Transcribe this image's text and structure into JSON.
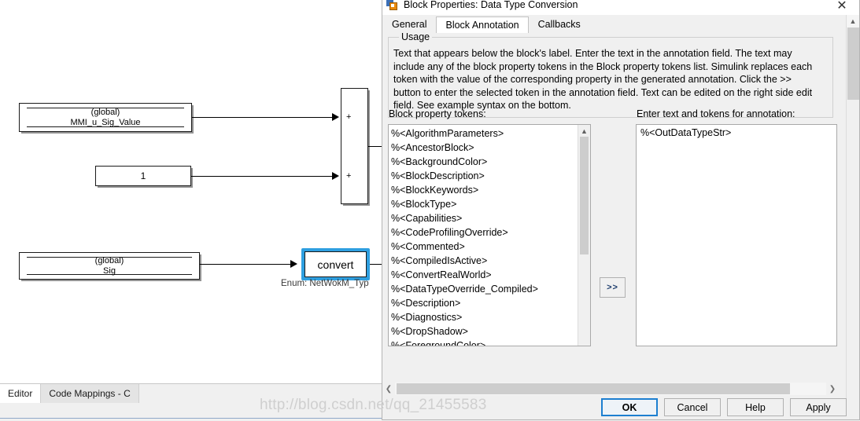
{
  "canvas": {
    "blocks": [
      {
        "name": "data-store-mmi",
        "scope": "(global)",
        "label": "MMI_u_Sig_Value"
      },
      {
        "name": "constant",
        "value": "1"
      },
      {
        "name": "data-store-sig",
        "scope": "(global)",
        "label": "Sig"
      }
    ],
    "sum_block": {
      "sign_top": "+",
      "sign_bottom": "+"
    },
    "convert_block": {
      "label": "convert",
      "annotation": "Enum: NetWokM_Typ"
    }
  },
  "statusbar": {
    "tabs": [
      {
        "label": "Editor",
        "active": true
      },
      {
        "label": "Code Mappings - C",
        "active": false
      }
    ]
  },
  "dialog": {
    "title": "Block Properties: Data Type Conversion",
    "close_label": "✕",
    "tabs": [
      {
        "label": "General",
        "active": false
      },
      {
        "label": "Block Annotation",
        "active": true
      },
      {
        "label": "Callbacks",
        "active": false
      }
    ],
    "usage": {
      "legend": "Usage",
      "text": "Text that appears below the block's label. Enter the text in the annotation field. The text may include any of the block property tokens in the Block property tokens list. Simulink replaces each token with the value of the corresponding property in the generated annotation. Click the >> button to enter the selected token in the annotation field. Text can be edited on the right side edit field. See example syntax on the bottom."
    },
    "tokens": {
      "label": "Block property tokens:",
      "items": [
        "%<AlgorithmParameters>",
        "%<AncestorBlock>",
        "%<BackgroundColor>",
        "%<BlockDescription>",
        "%<BlockKeywords>",
        "%<BlockType>",
        "%<Capabilities>",
        "%<CodeProfilingOverride>",
        "%<Commented>",
        "%<CompiledIsActive>",
        "%<ConvertRealWorld>",
        "%<DataTypeOverride_Compiled>",
        "%<Description>",
        "%<Diagnostics>",
        "%<DropShadow>",
        "%<ForegroundColor>"
      ]
    },
    "annotation": {
      "label": "Enter text and tokens for annotation:",
      "value": "%<OutDataTypeStr>"
    },
    "transfer_button": ">>",
    "buttons": [
      {
        "label": "OK",
        "default": true
      },
      {
        "label": "Cancel",
        "default": false
      },
      {
        "label": "Help",
        "default": false
      },
      {
        "label": "Apply",
        "default": false
      }
    ]
  },
  "watermark": {
    "text": "http://blog.csdn.net/qq_21455583"
  }
}
